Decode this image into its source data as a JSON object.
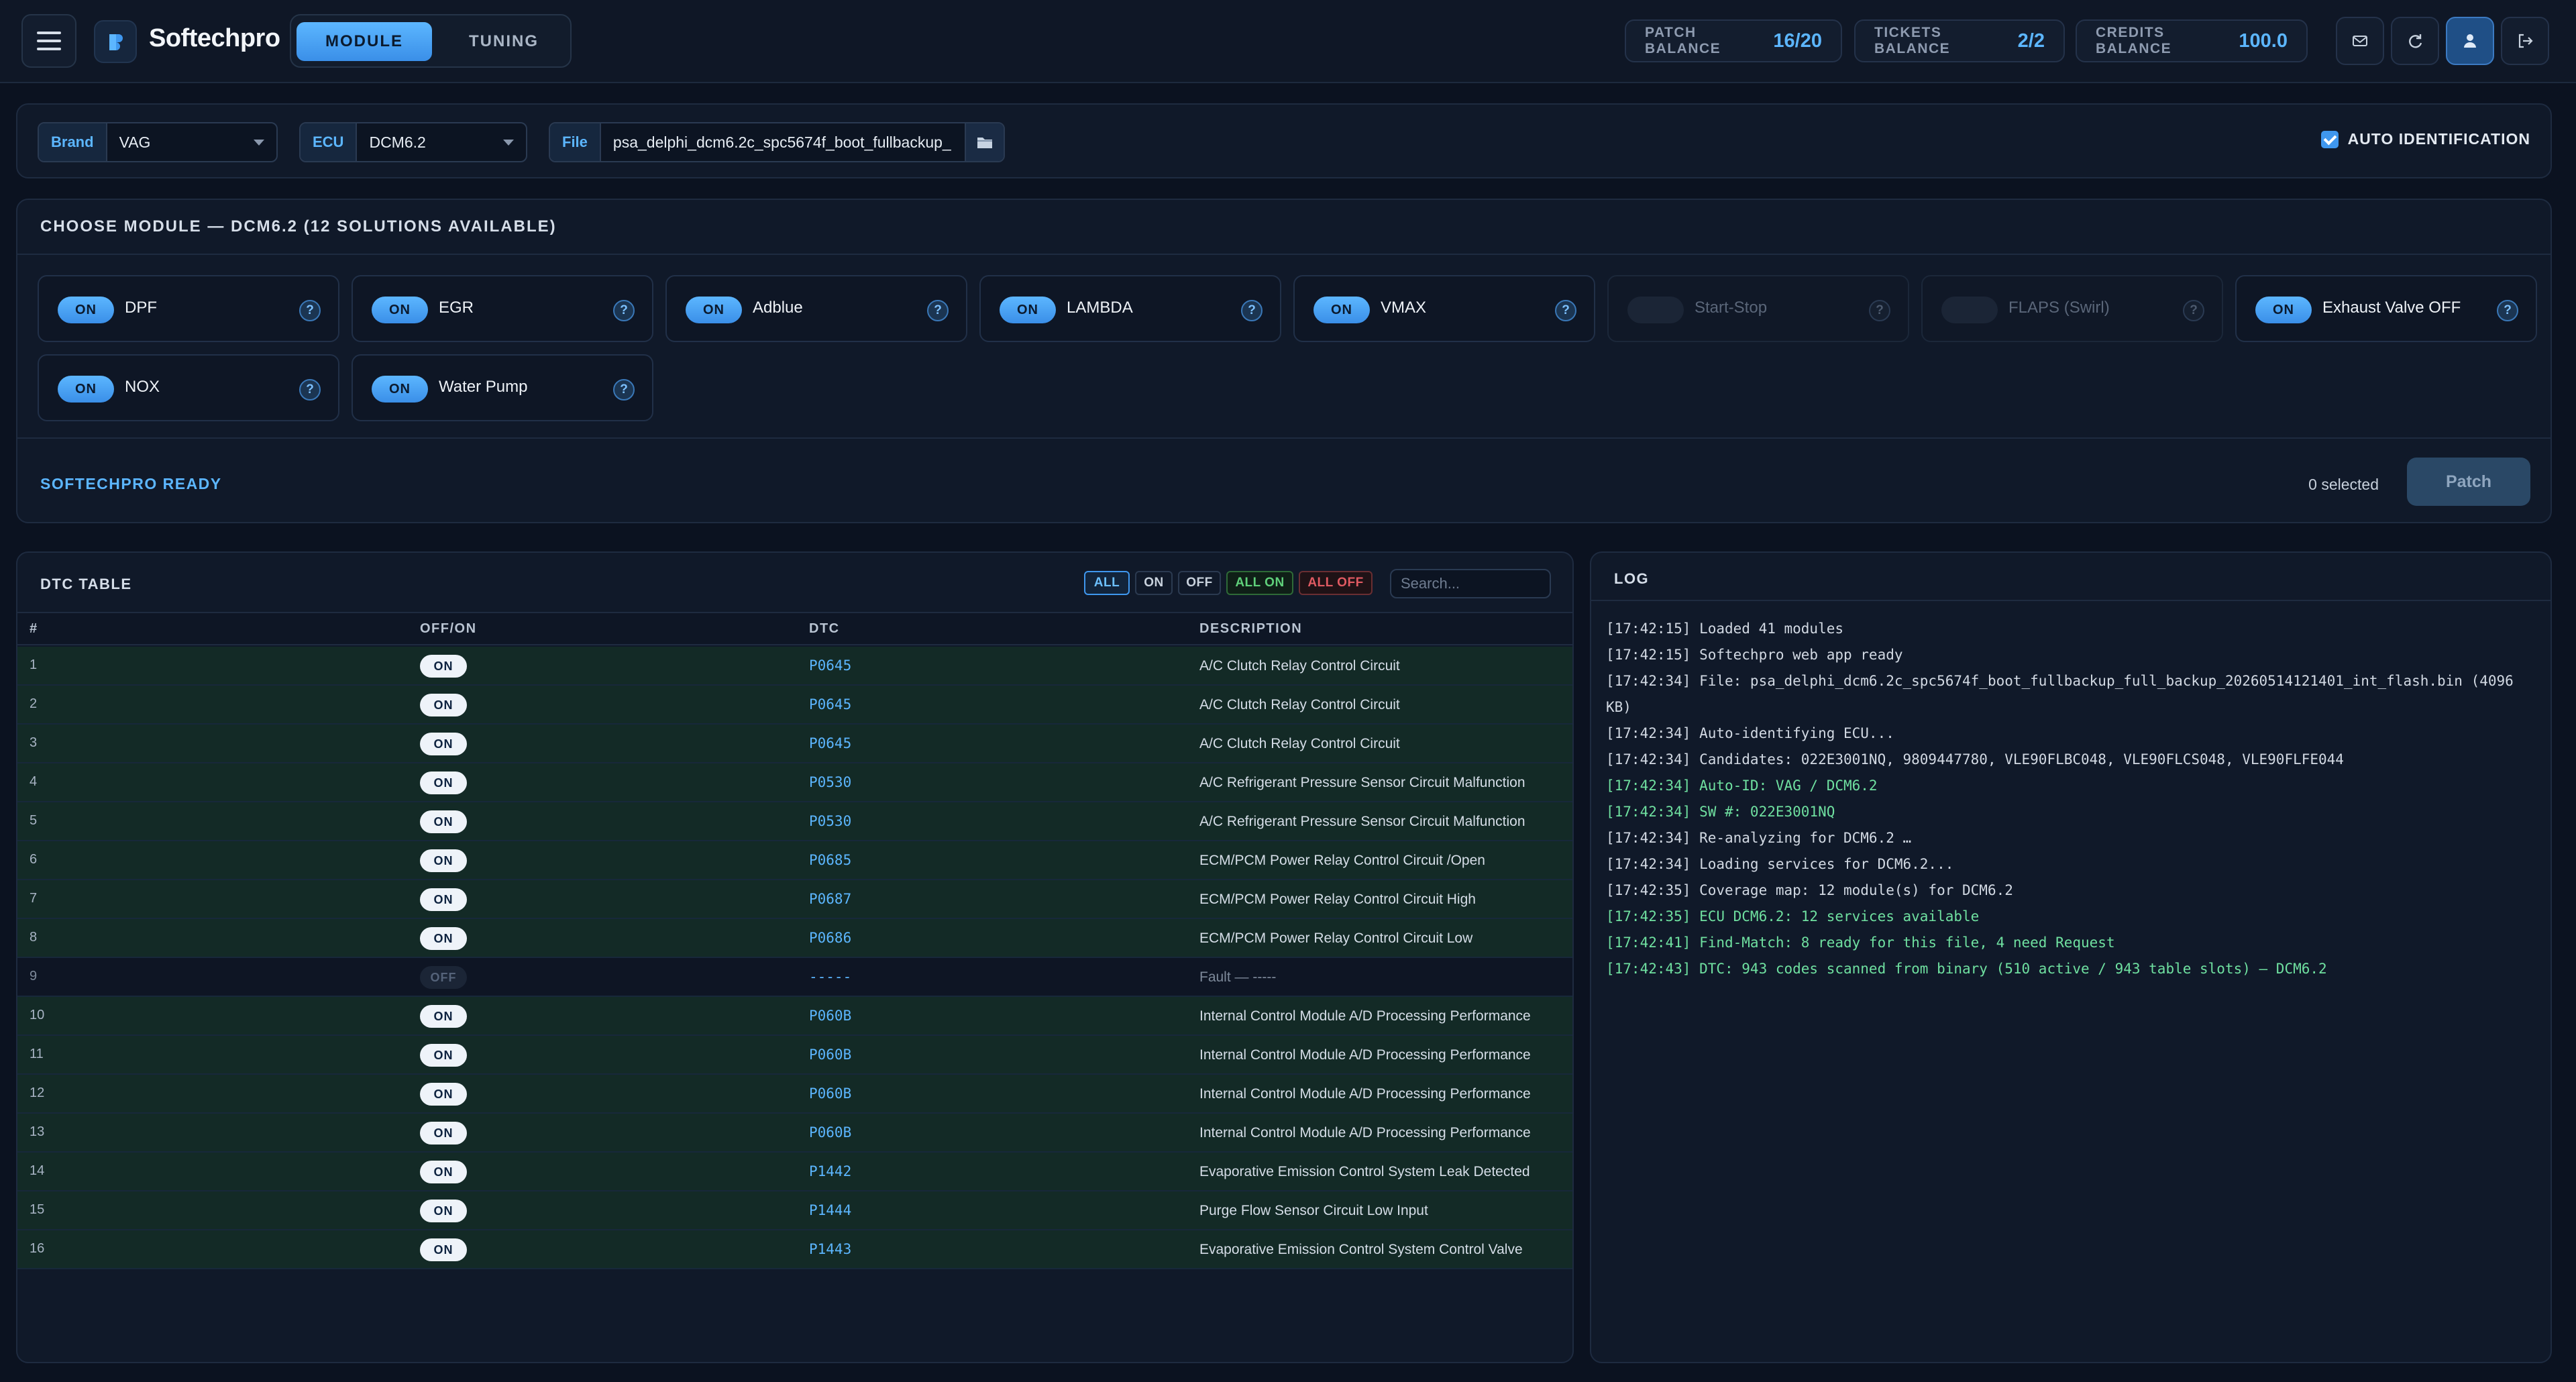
{
  "header": {
    "app_name": "Softechpro",
    "mode_tabs": [
      "MODULE",
      "TUNING"
    ],
    "balances": [
      {
        "label": "PATCH BALANCE",
        "value": "16/20"
      },
      {
        "label": "TICKETS BALANCE",
        "value": "2/2"
      },
      {
        "label": "CREDITS BALANCE",
        "value": "100.0"
      }
    ],
    "icons": [
      "mail-icon",
      "refresh-icon",
      "user-icon",
      "logout-icon"
    ]
  },
  "filters": {
    "brand_label": "Brand",
    "brand_value": "VAG",
    "ecu_label": "ECU",
    "ecu_value": "DCM6.2",
    "file_label": "File",
    "file_value": "psa_delphi_dcm6.2c_spc5674f_boot_fullbackup_",
    "auto_id_label": "AUTO IDENTIFICATION",
    "auto_id_checked": true
  },
  "modules": {
    "title": "CHOOSE MODULE — DCM6.2 (12 SOLUTIONS AVAILABLE)",
    "on_label": "ON",
    "help_label": "?",
    "items": [
      {
        "name": "DPF",
        "state": "on"
      },
      {
        "name": "EGR",
        "state": "on"
      },
      {
        "name": "Adblue",
        "state": "on"
      },
      {
        "name": "LAMBDA",
        "state": "on"
      },
      {
        "name": "VMAX",
        "state": "on"
      },
      {
        "name": "Start-Stop",
        "state": "disabled"
      },
      {
        "name": "FLAPS (Swirl)",
        "state": "disabled"
      },
      {
        "name": "Exhaust Valve OFF",
        "state": "on"
      },
      {
        "name": "NOX",
        "state": "on"
      },
      {
        "name": "Water Pump",
        "state": "on"
      }
    ],
    "status": "SOFTECHPRO READY",
    "selected": "0 selected",
    "patch_label": "Patch"
  },
  "dtc": {
    "title": "DTC TABLE",
    "filters": [
      "ALL",
      "ON",
      "OFF",
      "ALL ON",
      "ALL OFF"
    ],
    "search_placeholder": "Search...",
    "columns": [
      "#",
      "OFF/ON",
      "DTC",
      "DESCRIPTION"
    ],
    "rows": [
      {
        "n": "1",
        "state": "ON",
        "code": "P0645",
        "desc": "A/C Clutch Relay Control Circuit"
      },
      {
        "n": "2",
        "state": "ON",
        "code": "P0645",
        "desc": "A/C Clutch Relay Control Circuit"
      },
      {
        "n": "3",
        "state": "ON",
        "code": "P0645",
        "desc": "A/C Clutch Relay Control Circuit"
      },
      {
        "n": "4",
        "state": "ON",
        "code": "P0530",
        "desc": "A/C Refrigerant Pressure Sensor Circuit Malfunction"
      },
      {
        "n": "5",
        "state": "ON",
        "code": "P0530",
        "desc": "A/C Refrigerant Pressure Sensor Circuit Malfunction"
      },
      {
        "n": "6",
        "state": "ON",
        "code": "P0685",
        "desc": "ECM/PCM Power Relay Control Circuit /Open"
      },
      {
        "n": "7",
        "state": "ON",
        "code": "P0687",
        "desc": "ECM/PCM Power Relay Control Circuit High"
      },
      {
        "n": "8",
        "state": "ON",
        "code": "P0686",
        "desc": "ECM/PCM Power Relay Control Circuit Low"
      },
      {
        "n": "9",
        "state": "OFF",
        "code": "-----",
        "desc": "Fault — -----"
      },
      {
        "n": "10",
        "state": "ON",
        "code": "P060B",
        "desc": "Internal Control Module A/D Processing Performance"
      },
      {
        "n": "11",
        "state": "ON",
        "code": "P060B",
        "desc": "Internal Control Module A/D Processing Performance"
      },
      {
        "n": "12",
        "state": "ON",
        "code": "P060B",
        "desc": "Internal Control Module A/D Processing Performance"
      },
      {
        "n": "13",
        "state": "ON",
        "code": "P060B",
        "desc": "Internal Control Module A/D Processing Performance"
      },
      {
        "n": "14",
        "state": "ON",
        "code": "P1442",
        "desc": "Evaporative Emission Control System Leak Detected"
      },
      {
        "n": "15",
        "state": "ON",
        "code": "P1444",
        "desc": "Purge Flow Sensor Circuit Low Input"
      },
      {
        "n": "16",
        "state": "ON",
        "code": "P1443",
        "desc": "Evaporative Emission Control System Control Valve"
      }
    ]
  },
  "log": {
    "title": "LOG",
    "lines": [
      {
        "text": "[17:42:15] Loaded 41 modules",
        "tone": "normal"
      },
      {
        "text": "[17:42:15] Softechpro web app ready",
        "tone": "normal"
      },
      {
        "text": "[17:42:34] File: psa_delphi_dcm6.2c_spc5674f_boot_fullbackup_full_backup_20260514121401_int_flash.bin (4096 KB)",
        "tone": "normal"
      },
      {
        "text": "[17:42:34] Auto-identifying ECU...",
        "tone": "normal"
      },
      {
        "text": "[17:42:34] Candidates: 022E3001NQ, 9809447780, VLE90FLBC048, VLE90FLCS048, VLE90FLFE044",
        "tone": "normal"
      },
      {
        "text": "[17:42:34] Auto-ID: VAG / DCM6.2",
        "tone": "green"
      },
      {
        "text": "[17:42:34] SW #: 022E3001NQ",
        "tone": "green"
      },
      {
        "text": "[17:42:34] Re-analyzing for DCM6.2 …",
        "tone": "normal"
      },
      {
        "text": "[17:42:34] Loading services for DCM6.2...",
        "tone": "normal"
      },
      {
        "text": "[17:42:35] Coverage map: 12 module(s) for DCM6.2",
        "tone": "normal"
      },
      {
        "text": "[17:42:35] ECU DCM6.2: 12 services available",
        "tone": "green"
      },
      {
        "text": "[17:42:41] Find-Match: 8 ready for this file, 4 need Request",
        "tone": "green"
      },
      {
        "text": "[17:42:43] DTC: 943 codes scanned from binary (510 active / 943 table slots) — DCM6.2",
        "tone": "green"
      }
    ]
  }
}
